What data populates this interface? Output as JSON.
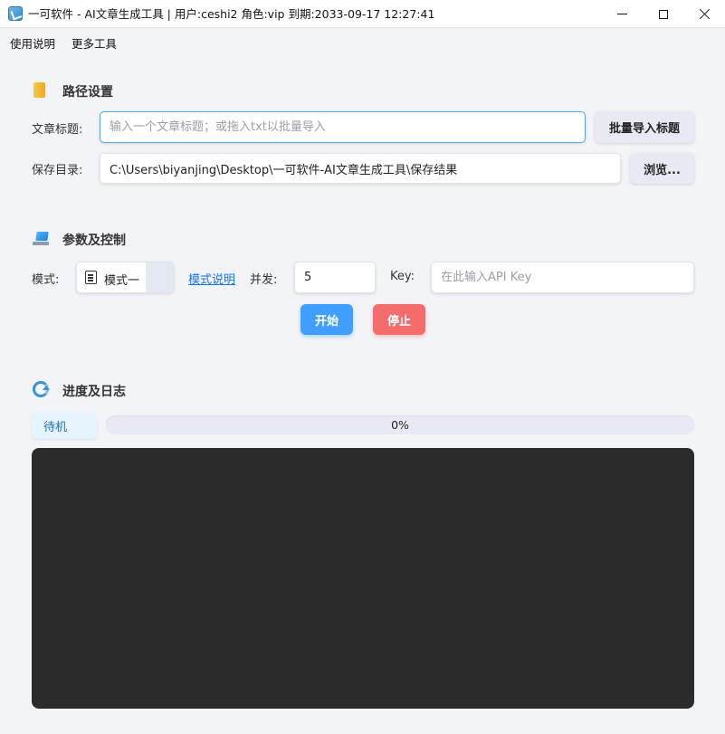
{
  "window": {
    "title": "一可软件 - AI文章生成工具  |  用户:ceshi2  角色:vip  到期:2033-09-17 12:27:41"
  },
  "menu": {
    "items": [
      "使用说明",
      "更多工具"
    ]
  },
  "path_section": {
    "title": "路径设置",
    "icon": "folder-icon",
    "article_title_label": "文章标题:",
    "article_title_placeholder": "输入一个文章标题；或拖入txt以批量导入",
    "article_title_value": "",
    "batch_import_label": "批量导入标题",
    "save_dir_label": "保存目录:",
    "save_dir_value": "C:\\Users\\biyanjing\\Desktop\\一可软件-AI文章生成工具\\保存结果",
    "browse_label": "浏览..."
  },
  "params_section": {
    "title": "参数及控制",
    "icon": "laptop-icon",
    "mode_label": "模式:",
    "mode_value": "模式一",
    "mode_help_link": "模式说明",
    "concurrency_label": "并发:",
    "concurrency_value": "5",
    "key_label": "Key:",
    "key_placeholder": "在此输入API Key",
    "key_value": "",
    "start_label": "开始",
    "stop_label": "停止"
  },
  "progress_section": {
    "title": "进度及日志",
    "icon": "refresh-icon",
    "status": "待机",
    "progress_value": 0,
    "progress_text": "0%",
    "log": ""
  },
  "colors": {
    "accent": "#409eff",
    "danger": "#f56c6c",
    "log_bg": "#2b2b2b"
  }
}
